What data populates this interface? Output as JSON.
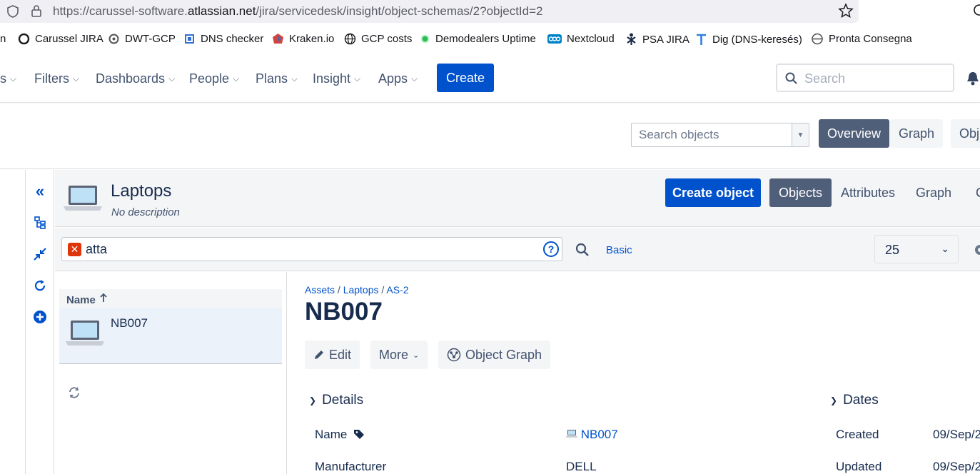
{
  "browser": {
    "url_prefix": "https://carussel-software.",
    "url_domain": "atlassian.net",
    "url_suffix": "/jira/servicedesk/insight/object-schemas/2?objectId=2",
    "bookmarks": [
      {
        "label": "n",
        "icon": ""
      },
      {
        "label": "Carussel JIRA",
        "icon": "jira-icon"
      },
      {
        "label": "DWT-GCP",
        "icon": "gcp-icon"
      },
      {
        "label": "DNS checker",
        "icon": "chip-icon"
      },
      {
        "label": "Kraken.io",
        "icon": "kraken-icon"
      },
      {
        "label": "GCP costs",
        "icon": "globe-icon"
      },
      {
        "label": "Demodealers Uptime",
        "icon": "status-dot-icon"
      },
      {
        "label": "Nextcloud",
        "icon": "nextcloud-icon"
      },
      {
        "label": "PSA JIRA",
        "icon": "psa-icon"
      },
      {
        "label": "Dig (DNS-keresés)",
        "icon": "t-icon"
      },
      {
        "label": "Pronta Consegna",
        "icon": "pronta-icon"
      }
    ]
  },
  "nav": {
    "items": [
      "s",
      "Filters",
      "Dashboards",
      "People",
      "Plans",
      "Insight",
      "Apps"
    ],
    "create": "Create",
    "search_placeholder": "Search"
  },
  "schema_bar": {
    "search_placeholder": "Search objects",
    "tabs": [
      "Overview",
      "Graph",
      "Obj"
    ],
    "active_tab": "Overview"
  },
  "object_type": {
    "title": "Laptops",
    "description": "No description",
    "create_button": "Create object",
    "tabs": [
      "Objects",
      "Attributes",
      "Graph",
      "C"
    ],
    "active_tab": "Objects"
  },
  "filter": {
    "query": "atta",
    "mode_link": "Basic",
    "page_size": "25"
  },
  "list": {
    "column": "Name",
    "rows": [
      {
        "name": "NB007"
      }
    ]
  },
  "detail": {
    "crumbs": [
      "Assets",
      "Laptops",
      "AS-2"
    ],
    "title": "NB007",
    "actions": {
      "edit": "Edit",
      "more": "More",
      "graph": "Object Graph"
    },
    "sections": {
      "details": "Details",
      "dates": "Dates"
    },
    "attributes": [
      {
        "label": "Name",
        "value": "NB007"
      },
      {
        "label": "Manufacturer",
        "value": "DELL"
      }
    ],
    "dates": [
      {
        "label": "Created",
        "value": "09/Sep/2"
      },
      {
        "label": "Updated",
        "value": "09/Sep/2"
      }
    ]
  }
}
